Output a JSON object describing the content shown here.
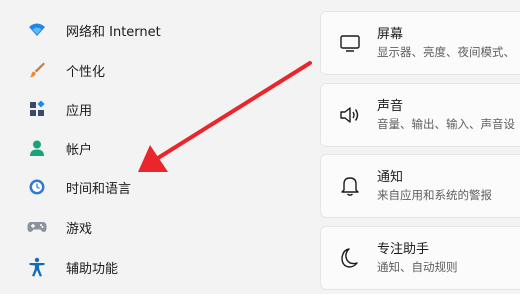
{
  "sidebar": {
    "items": [
      {
        "label": "网络和 Internet",
        "icon": "wifi-icon"
      },
      {
        "label": "个性化",
        "icon": "brush-icon"
      },
      {
        "label": "应用",
        "icon": "apps-icon"
      },
      {
        "label": "帐户",
        "icon": "person-icon"
      },
      {
        "label": "时间和语言",
        "icon": "globe-clock-icon"
      },
      {
        "label": "游戏",
        "icon": "gamepad-icon"
      },
      {
        "label": "辅助功能",
        "icon": "accessibility-icon"
      }
    ]
  },
  "main": {
    "cards": [
      {
        "title": "屏幕",
        "subtitle": "显示器、亮度、夜间模式、",
        "icon": "monitor-icon"
      },
      {
        "title": "声音",
        "subtitle": "音量、输出、输入、声音设",
        "icon": "speaker-icon"
      },
      {
        "title": "通知",
        "subtitle": "来自应用和系统的警报",
        "icon": "bell-icon"
      },
      {
        "title": "专注助手",
        "subtitle": "通知、自动规则",
        "icon": "moon-icon"
      }
    ]
  },
  "colors": {
    "background": "#f3f3f3",
    "card": "#fbfbfb",
    "accent_blue": "#0067c0",
    "annotation_red": "#e8262b"
  }
}
